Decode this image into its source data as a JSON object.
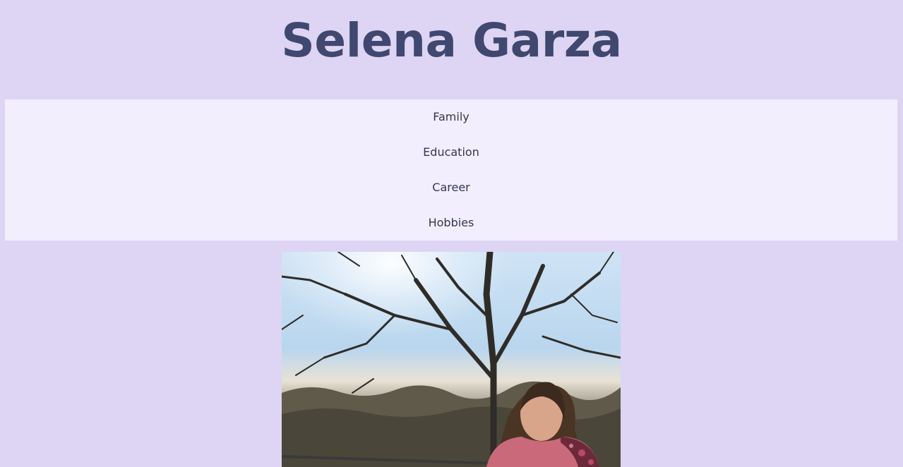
{
  "header": {
    "title": "Selena Garza"
  },
  "nav": {
    "items": [
      {
        "label": "Family"
      },
      {
        "label": "Education"
      },
      {
        "label": "Career"
      },
      {
        "label": "Hobbies"
      }
    ]
  },
  "colors": {
    "page_background": "#ddd5f3",
    "nav_background": "#f3eefd",
    "title_color": "#404870",
    "nav_text_color": "#33364f"
  }
}
